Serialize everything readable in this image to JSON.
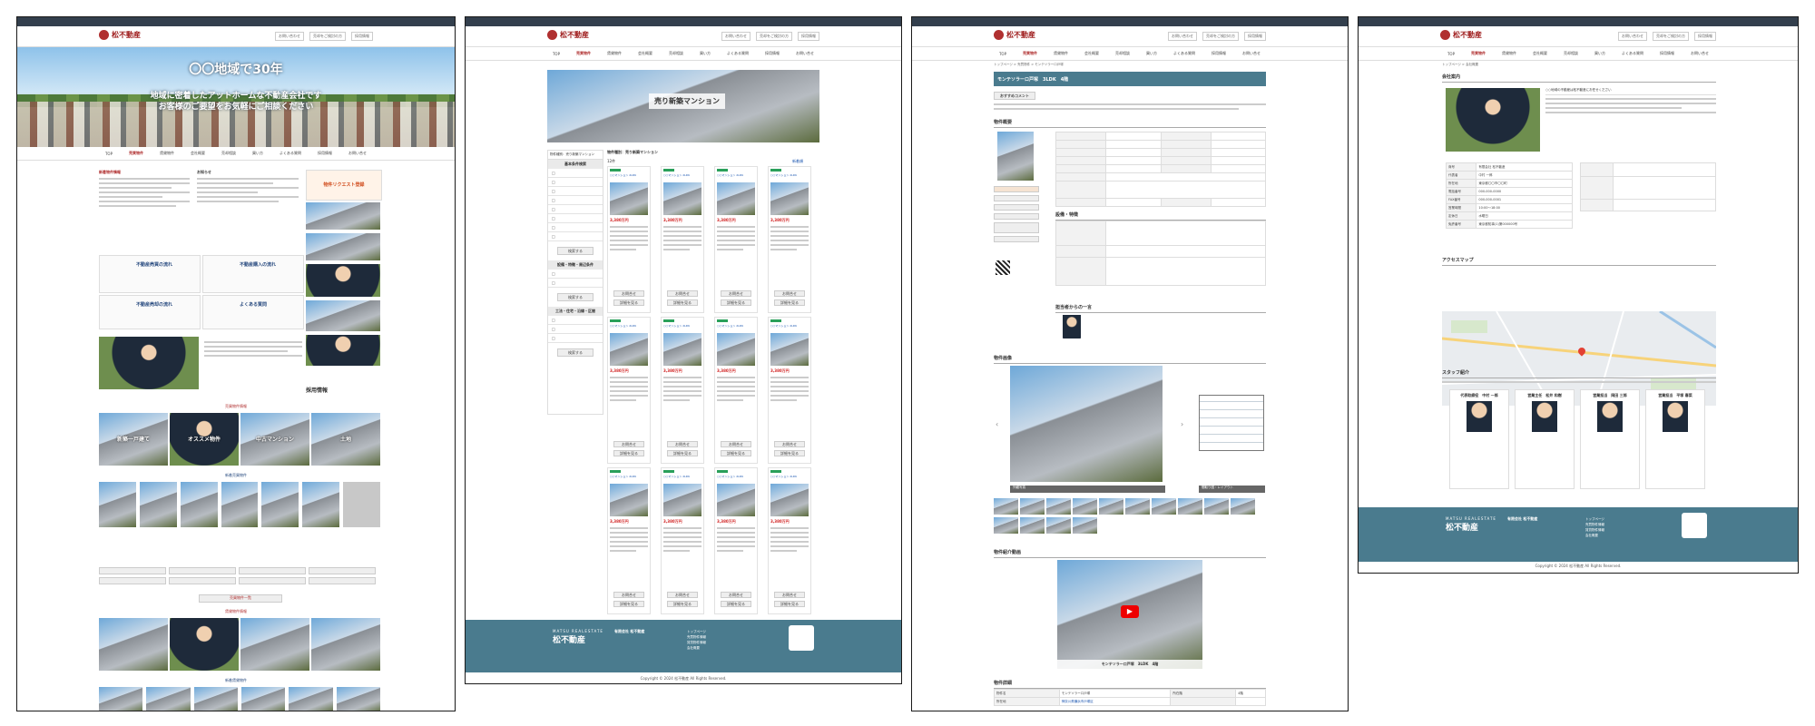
{
  "site": {
    "logo_text": "松不動産",
    "header_links": [
      "お問い合わせ",
      "売却をご検討の方",
      "採用情報"
    ],
    "nav": [
      "TOP",
      "売買物件",
      "賃貸物件",
      "会社概要",
      "売却相談",
      "買い方",
      "よくある質問",
      "採用情報",
      "お問い合せ"
    ],
    "footer": {
      "brand_small": "MATSU REALESTATE",
      "brand": "松不動産",
      "company": "有限会社 松不動産",
      "links": [
        "トップページ",
        "売買物件情報",
        "賃貸物件情報",
        "会社概要",
        "採用情報",
        "お問い合わせ"
      ],
      "copyright": "Copyright © 2024 松不動産 All Rights Reserved."
    }
  },
  "panel1": {
    "hero_title": "〇〇地域で30年",
    "hero_sub1": "地域に密着したアットホームな不動産会社です",
    "hero_sub2": "お客様のご要望をお気軽にご相談ください",
    "news_title": "新着物件情報",
    "notice_title": "お知らせ",
    "banner_request": "物件リクエスト登録",
    "guide_buy": "不動産売買の流れ",
    "guide_purchase": "不動産購入の流れ",
    "guide_sell": "不動産売却の流れ",
    "guide_faq": "よくある質問",
    "recruit": "採用情報",
    "section_sale": "売買物件情報",
    "section_new": "新着売買物件",
    "section_rent": "賃貸物件情報",
    "section_new_rent": "新着賃貸物件",
    "more_label": "売買物件一覧",
    "tiles": [
      "新築一戸建て",
      "オススメ物件",
      "中古マンション",
      "土地"
    ]
  },
  "panel2": {
    "page_title": "売り新築マンション",
    "search_label": "物件種別：売り新築マンション",
    "side_head_1": "基本条件検索",
    "side_head_2": "設備・特徴・周辺条件",
    "side_head_3": "工法・住宅・沿線・区間",
    "side_btn": "検索する",
    "count_label": "12件",
    "sort_label": "新着順",
    "listing_price": "3,380万円",
    "listing_name": "○○マンション 2LDK",
    "listing_button": "お問合せ",
    "listing_button2": "詳細を見る"
  },
  "panel3": {
    "property_title": "モンテソラーロ戸塚　3LDK　4階",
    "breadcrumb": "トップページ > 売買物件 > モンテソラーロ戸塚",
    "comment_title": "おすすめコメント",
    "section_overview": "物件概要",
    "section_equipment": "設備・特徴",
    "section_staff": "担当者からの一言",
    "section_gallery": "物件画像",
    "section_video": "物件紹介動画",
    "section_detail": "物件詳細",
    "video_caption": "モンテソラーロ戸塚　3LDK　4階",
    "gallery_caption_left": "外観写真",
    "gallery_caption_right": "間取り図・レイアウト",
    "detail_rows": [
      [
        "物件名",
        "モンテソラーロ戸塚",
        "所在階",
        "4階"
      ],
      [
        "所在地",
        "神奈川県横浜市戸塚区",
        "",
        ""
      ]
    ]
  },
  "panel4": {
    "breadcrumb": "トップページ > 会社概要",
    "section_company": "会社案内",
    "greeting_title": "○○地域の不動産は松不動産にお任せください",
    "section_access": "アクセスマップ",
    "section_staff": "スタッフ紹介",
    "staff": [
      {
        "name": "代表取締役　中村 一郎"
      },
      {
        "name": "営業主任　松井 和樹"
      },
      {
        "name": "営業担当　岡田 三郎"
      },
      {
        "name": "営業担当　平塚 春菜"
      }
    ],
    "company_rows": [
      [
        "商号",
        "有限会社 松不動産"
      ],
      [
        "代表者",
        "中村 一郎"
      ],
      [
        "所在地",
        "東京都〇〇市〇〇町"
      ],
      [
        "電話番号",
        "000-000-0000"
      ],
      [
        "FAX番号",
        "000-000-0001"
      ],
      [
        "営業時間",
        "10:00〜18:00"
      ],
      [
        "定休日",
        "水曜日"
      ],
      [
        "免許番号",
        "東京都知事(1)第000000号"
      ]
    ]
  }
}
